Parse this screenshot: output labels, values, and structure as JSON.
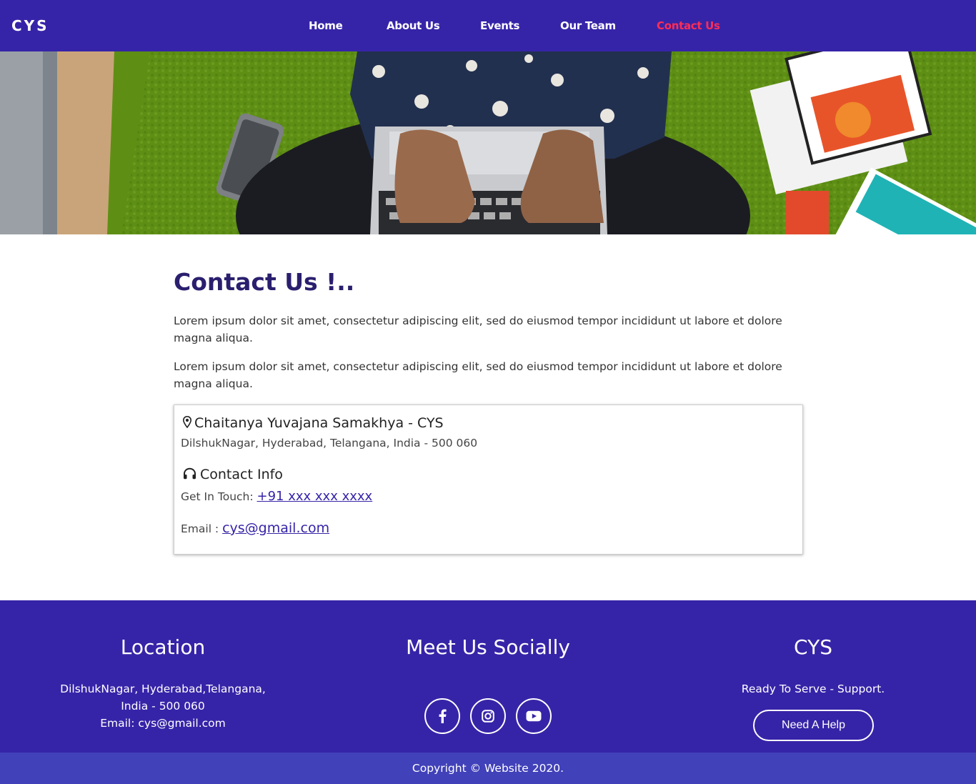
{
  "nav": {
    "brand": "CYS",
    "links": [
      "Home",
      "About Us",
      "Events",
      "Our Team",
      "Contact Us"
    ],
    "active_color": "#ff2d55"
  },
  "colors": {
    "primary": "#3624a8",
    "footer_bottom": "#4141ba",
    "title": "#2a1f6e"
  },
  "hero": {
    "image": "person-typing-on-laptop-on-green-rug"
  },
  "main": {
    "title": "Contact Us !..",
    "paragraphs": [
      "Lorem ipsum dolor sit amet, consectetur adipiscing elit, sed do eiusmod tempor incididunt ut labore et dolore magna aliqua.",
      "Lorem ipsum dolor sit amet, consectetur adipiscing elit, sed do eiusmod tempor incididunt ut labore et dolore magna aliqua."
    ]
  },
  "card": {
    "org_icon": "map-marker-icon",
    "org_name": "Chaitanya Yuvajana Samakhya - CYS",
    "address": "DilshukNagar, Hyderabad, Telangana, India - 500 060",
    "contact_icon": "headphones-icon",
    "contact_title": "Contact Info",
    "touch_label": "Get In Touch: ",
    "phone": "+91 xxx xxx xxxx",
    "email_label": "Email : ",
    "email": "cys@gmail.com"
  },
  "footer": {
    "location_heading": "Location",
    "location_lines": [
      "DilshukNagar, Hyderabad,Telangana,",
      "India - 500 060",
      "Email: cys@gmail.com"
    ],
    "social_heading": "Meet Us Socially",
    "social_icons": [
      "facebook-icon",
      "instagram-icon",
      "youtube-icon"
    ],
    "cys_heading": "CYS",
    "cys_text": "Ready To Serve - Support.",
    "help_button": "Need A Help",
    "copyright": "Copyright © Website 2020."
  }
}
